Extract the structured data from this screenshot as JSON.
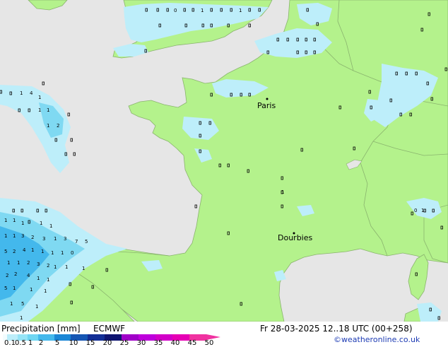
{
  "map": {
    "colors": {
      "sea": "#e6e6e6",
      "land": "#b4f28c",
      "border": "#8ab46e",
      "precip_light": "#bdeefa",
      "precip_mid": "#7fd9f2",
      "precip_heavy": "#43b8ec"
    },
    "cities": [
      {
        "name": "Paris"
      },
      {
        "name": "Dourbies"
      }
    ]
  },
  "footer": {
    "title": "Precipitation [mm]",
    "model": "ECMWF",
    "datetime": "Fr 28-03-2025 12..18 UTC (00+258)",
    "credit": "©weatheronline.co.uk"
  },
  "legend": {
    "ticks": [
      "0.1",
      "0.5",
      "1",
      "2",
      "5",
      "10",
      "15",
      "20",
      "25",
      "30",
      "35",
      "40",
      "45",
      "50"
    ],
    "colors": [
      "#f2fcfe",
      "#bdeefa",
      "#96e4f6",
      "#6fd6f2",
      "#43b8ec",
      "#1a86d6",
      "#1556b4",
      "#122e96",
      "#0e1470",
      "#a000c8",
      "#be00dc",
      "#d200c8",
      "#e600b4",
      "#f032a0"
    ]
  }
}
